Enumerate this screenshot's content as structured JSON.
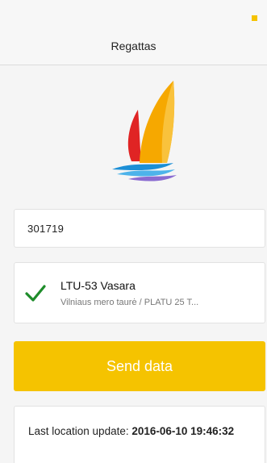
{
  "header": {
    "title": "Regattas"
  },
  "colors": {
    "accent": "#f5c300",
    "check": "#1e8c2a",
    "sail_red": "#e02424",
    "sail_orange": "#f6a800",
    "water_blue": "#1c8fd6"
  },
  "logo": {
    "icon": "sailboat-logo-icon"
  },
  "code_field": {
    "value": "301719"
  },
  "boat": {
    "icon": "checkmark-icon",
    "name": "LTU-53 Vasara",
    "event": "Vilniaus mero taurė / PLATU 25 T..."
  },
  "send_button": {
    "label": "Send data"
  },
  "location": {
    "label": "Last location update: ",
    "time": "2016-06-10 19:46:32"
  }
}
